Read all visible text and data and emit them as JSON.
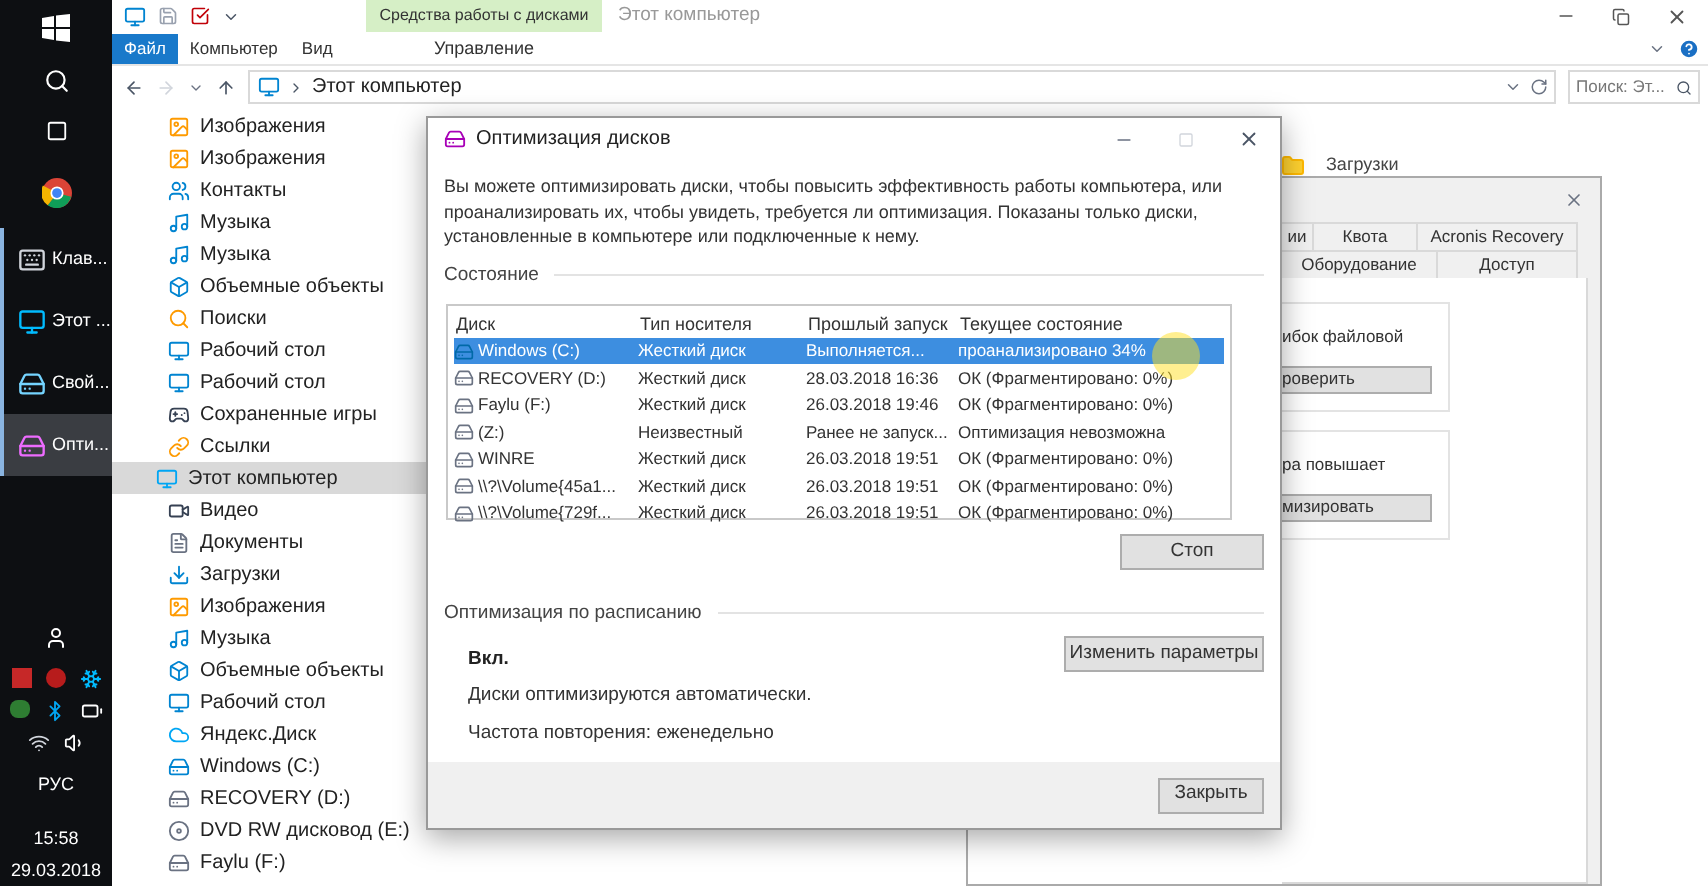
{
  "taskbar": {
    "apps": [
      {
        "label": "Клав...",
        "kind": "keyboard",
        "selected": false
      },
      {
        "label": "Этот ...",
        "kind": "pc",
        "selected": false
      },
      {
        "label": "Свой...",
        "kind": "drive",
        "selected": false
      },
      {
        "label": "Опти...",
        "kind": "optimize",
        "selected": true
      }
    ],
    "language": "РУС",
    "time": "15:58",
    "date": "29.03.2018"
  },
  "explorer": {
    "context_group": "Средства работы с дисками",
    "title": "Этот компьютер",
    "ribbon_tabs": [
      {
        "label": "Файл",
        "kind": "file"
      },
      {
        "label": "Компьютер",
        "kind": "tab"
      },
      {
        "label": "Вид",
        "kind": "tab"
      },
      {
        "label": "Управление",
        "kind": "context"
      }
    ],
    "address": "Этот компьютер",
    "search": {
      "placeholder": "Поиск: Эт..."
    },
    "nav_partial_children": [
      {
        "label": "Изображения",
        "kind": "pictures"
      },
      {
        "label": "Изображения",
        "kind": "pictures"
      },
      {
        "label": "Контакты",
        "kind": "contacts"
      },
      {
        "label": "Музыка",
        "kind": "music"
      },
      {
        "label": "Музыка",
        "kind": "music"
      },
      {
        "label": "Объемные объекты",
        "kind": "objects"
      },
      {
        "label": "Поиски",
        "kind": "search"
      },
      {
        "label": "Рабочий стол",
        "kind": "desktop"
      },
      {
        "label": "Рабочий стол",
        "kind": "desktop"
      },
      {
        "label": "Сохраненные игры",
        "kind": "games"
      },
      {
        "label": "Ссылки",
        "kind": "links"
      }
    ],
    "nav_tree": [
      {
        "label": "Этот компьютер",
        "kind": "pc",
        "selected": true,
        "children": [
          {
            "label": "Видео",
            "kind": "video",
            "selected": false
          },
          {
            "label": "Документы",
            "kind": "documents",
            "selected": false
          },
          {
            "label": "Загрузки",
            "kind": "downloads",
            "selected": false
          },
          {
            "label": "Изображения",
            "kind": "pictures",
            "selected": false
          },
          {
            "label": "Музыка",
            "kind": "music",
            "selected": false
          },
          {
            "label": "Объемные объекты",
            "kind": "objects",
            "selected": false
          },
          {
            "label": "Рабочий стол",
            "kind": "desktop",
            "selected": false
          },
          {
            "label": "Яндекс.Диск",
            "kind": "cloud",
            "selected": false
          },
          {
            "label": "Windows (C:)",
            "kind": "system",
            "selected": false
          },
          {
            "label": "RECOVERY (D:)",
            "kind": "drive",
            "selected": false
          },
          {
            "label": "DVD RW дисковод (E:)",
            "kind": "dvd",
            "selected": false
          },
          {
            "label": "Faylu (F:)",
            "kind": "drive",
            "selected": false
          }
        ]
      }
    ],
    "content_items": [
      "Загрузки"
    ]
  },
  "optimize_dialog": {
    "title": "Оптимизация дисков",
    "description": "Вы можете оптимизировать диски, чтобы повысить эффективность работы  компьютера, или проанализировать их, чтобы увидеть, требуется ли оптимизация. Показаны только диски, установленные в компьютере или подключенные к нему.",
    "status_heading": "Состояние",
    "columns": [
      "Диск",
      "Тип носителя",
      "Прошлый запуск",
      "Текущее состояние"
    ],
    "rows": [
      {
        "kind": "system",
        "selected": true,
        "cells": [
          "Windows (C:)",
          "Жесткий диск",
          "Выполняется...",
          "проанализировано 34%"
        ]
      },
      {
        "kind": "drive",
        "selected": false,
        "cells": [
          "RECOVERY (D:)",
          "Жесткий диск",
          "28.03.2018 16:36",
          "ОК (Фрагментировано: 0%)"
        ]
      },
      {
        "kind": "drive",
        "selected": false,
        "cells": [
          "Faylu (F:)",
          "Жесткий диск",
          "26.03.2018 19:46",
          "ОК (Фрагментировано: 0%)"
        ]
      },
      {
        "kind": "drive",
        "selected": false,
        "cells": [
          "(Z:)",
          "Неизвестный",
          "Ранее не запуск...",
          "Оптимизация невозможна"
        ]
      },
      {
        "kind": "drive",
        "selected": false,
        "cells": [
          "WINRE",
          "Жесткий диск",
          "26.03.2018 19:51",
          "ОК (Фрагментировано: 0%)"
        ]
      },
      {
        "kind": "drive",
        "selected": false,
        "cells": [
          "\\\\?\\Volume{45a1...",
          "Жесткий диск",
          "26.03.2018 19:51",
          "ОК (Фрагментировано: 0%)"
        ]
      },
      {
        "kind": "drive",
        "selected": false,
        "cells": [
          "\\\\?\\Volume{729f...",
          "Жесткий диск",
          "26.03.2018 19:51",
          "ОК (Фрагментировано: 0%)"
        ]
      }
    ],
    "stop_button": "Стоп",
    "schedule_heading": "Оптимизация по расписанию",
    "schedule_state": "Вкл.",
    "schedule_lines": [
      "Диски оптимизируются автоматически.",
      "Частота повторения: еженедельно"
    ],
    "change_button": "Изменить параметры",
    "close_button": "Закрыть"
  },
  "properties_dialog": {
    "tabs_row_1": [
      {
        "label": "ии",
        "selected": false
      },
      {
        "label": "Квота",
        "selected": false
      },
      {
        "label": "Acronis Recovery",
        "selected": false
      }
    ],
    "tabs_row_2": [
      {
        "label": "Оборудование",
        "selected": false
      },
      {
        "label": "Доступ",
        "selected": false
      }
    ],
    "groups": [
      {
        "text": "ибок файловой",
        "button": "роверить"
      },
      {
        "text": "ра повышает",
        "button": "мизировать"
      }
    ]
  }
}
